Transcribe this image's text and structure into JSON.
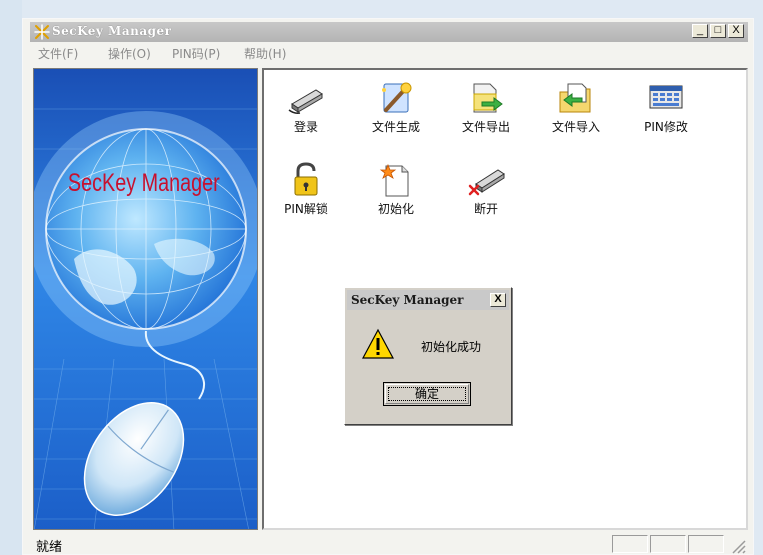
{
  "window": {
    "title": "SecKey Manager",
    "minimize": "_",
    "maximize": "□",
    "close": "X"
  },
  "menu": [
    {
      "label": "文件(F)"
    },
    {
      "label": "操作(O)"
    },
    {
      "label": "PIN码(P)"
    },
    {
      "label": "帮助(H)"
    }
  ],
  "sidebar": {
    "brand": "SecKey Manager"
  },
  "toolbar": {
    "login": "登录",
    "generate_file": "文件生成",
    "export_file": "文件导出",
    "import_file": "文件导入",
    "pin_change": "PIN修改",
    "pin_unlock": "PIN解锁",
    "initialize": "初始化",
    "disconnect": "断开"
  },
  "dialog": {
    "title": "SecKey Manager",
    "close": "X",
    "message": "初始化成功",
    "ok_label": "确定"
  },
  "status": {
    "text": "就绪"
  },
  "colors": {
    "title_bar": "#bdbdbd",
    "window_bg": "#f3f3ef",
    "sidebar_blue": "#1f6fd6",
    "brand_red": "#c8102e",
    "warning_yellow": "#ffd700"
  }
}
